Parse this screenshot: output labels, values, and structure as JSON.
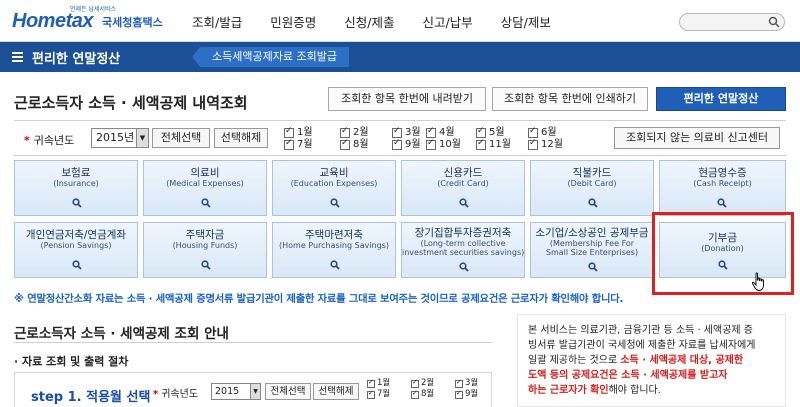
{
  "header": {
    "logo_text": "Hometax",
    "logo_sub": "국세청홈택스",
    "logo_tag": "언제든 납세서비스",
    "nav": [
      "조회/발급",
      "민원증명",
      "신청/제출",
      "신고/납부",
      "상담/제보"
    ]
  },
  "subbar": {
    "menu_label": "편리한 연말정산",
    "current_tab": "소득세액공제자료 조회발급"
  },
  "main": {
    "title": "근로소득자 소득 · 세액공제 내역조회",
    "buttons": {
      "download": "조회한 항목 한번에 내려받기",
      "print": "조회한 항목 한번에 인쇄하기",
      "convenient": "편리한 연말정산"
    },
    "year_label": "귀속년도",
    "year_value": "2015년",
    "select_all": "전체선택",
    "deselect": "선택해제",
    "months": [
      "1월",
      "2월",
      "3월",
      "4월",
      "5월",
      "6월",
      "7월",
      "8월",
      "9월",
      "10월",
      "11월",
      "12월"
    ],
    "medical_report_button": "조회되지 않는 의료비 신고센터"
  },
  "cards": [
    {
      "title": "보험료",
      "sub": [
        "(Insurance)"
      ]
    },
    {
      "title": "의료비",
      "sub": [
        "(Medical Expenses)"
      ]
    },
    {
      "title": "교육비",
      "sub": [
        "(Education Expenses)"
      ]
    },
    {
      "title": "신용카드",
      "sub": [
        "(Credit Card)"
      ]
    },
    {
      "title": "직불카드",
      "sub": [
        "(Debit Card)"
      ]
    },
    {
      "title": "현금영수증",
      "sub": [
        "(Cash Receipt)"
      ]
    },
    {
      "title": "개인연금저축/연금계좌",
      "sub": [
        "(Pension Savings)"
      ]
    },
    {
      "title": "주택자금",
      "sub": [
        "(Housing Funds)"
      ]
    },
    {
      "title": "주택마련저축",
      "sub": [
        "(Home Purchasing Savings)"
      ]
    },
    {
      "title": "장기집합투자증권저축",
      "sub": [
        "(Long-term collective",
        "investment securities savings)"
      ]
    },
    {
      "title": "소기업/소상공인 공제부금",
      "sub": [
        "(Membership Fee For",
        "Small Size Enterprises)"
      ]
    },
    {
      "title": "기부금",
      "sub": [
        "(Donation)"
      ]
    }
  ],
  "notice": "※ 연말정산간소화 자료는 소득 · 세액공제 증명서류 발급기관이 제출한 자료를 그대로 보여주는 것이므로 공제요건은 근로자가 확인해야 합니다.",
  "guide": {
    "title": "근로소득자 소득 · 세액공제 조회 안내",
    "subtitle": "· 자료 조회 및 출력 절차",
    "step_num": "step 1.",
    "step_name": "적용월 선택",
    "step_year_label": "귀속년도",
    "step_year_value": "2015",
    "step_select_all": "전체선택",
    "step_deselect": "선택해제",
    "step_months": [
      "1월",
      "2월",
      "3월",
      "7월",
      "8월",
      "9월"
    ]
  },
  "info": {
    "line1": "본 서비스는 의료기관, 금융기관 등 소득 · 세액공제 증",
    "line2": "빙서류 발급기관이 국세청에 제출한 자료를 납세자에게",
    "line3a": "일괄 제공하는 것으로 ",
    "line3b": "소득 · 세액공제 대상, 공제한",
    "line4": "도액 등의 공제요건은 소득 · 세액공제를 받고자",
    "line5a": "하는 근로자가 확인",
    "line5b": "해야 합니다."
  },
  "colors": {
    "brand_blue": "#1b4f96",
    "highlight_red": "#e02020",
    "notice_blue": "#1a63c4"
  }
}
